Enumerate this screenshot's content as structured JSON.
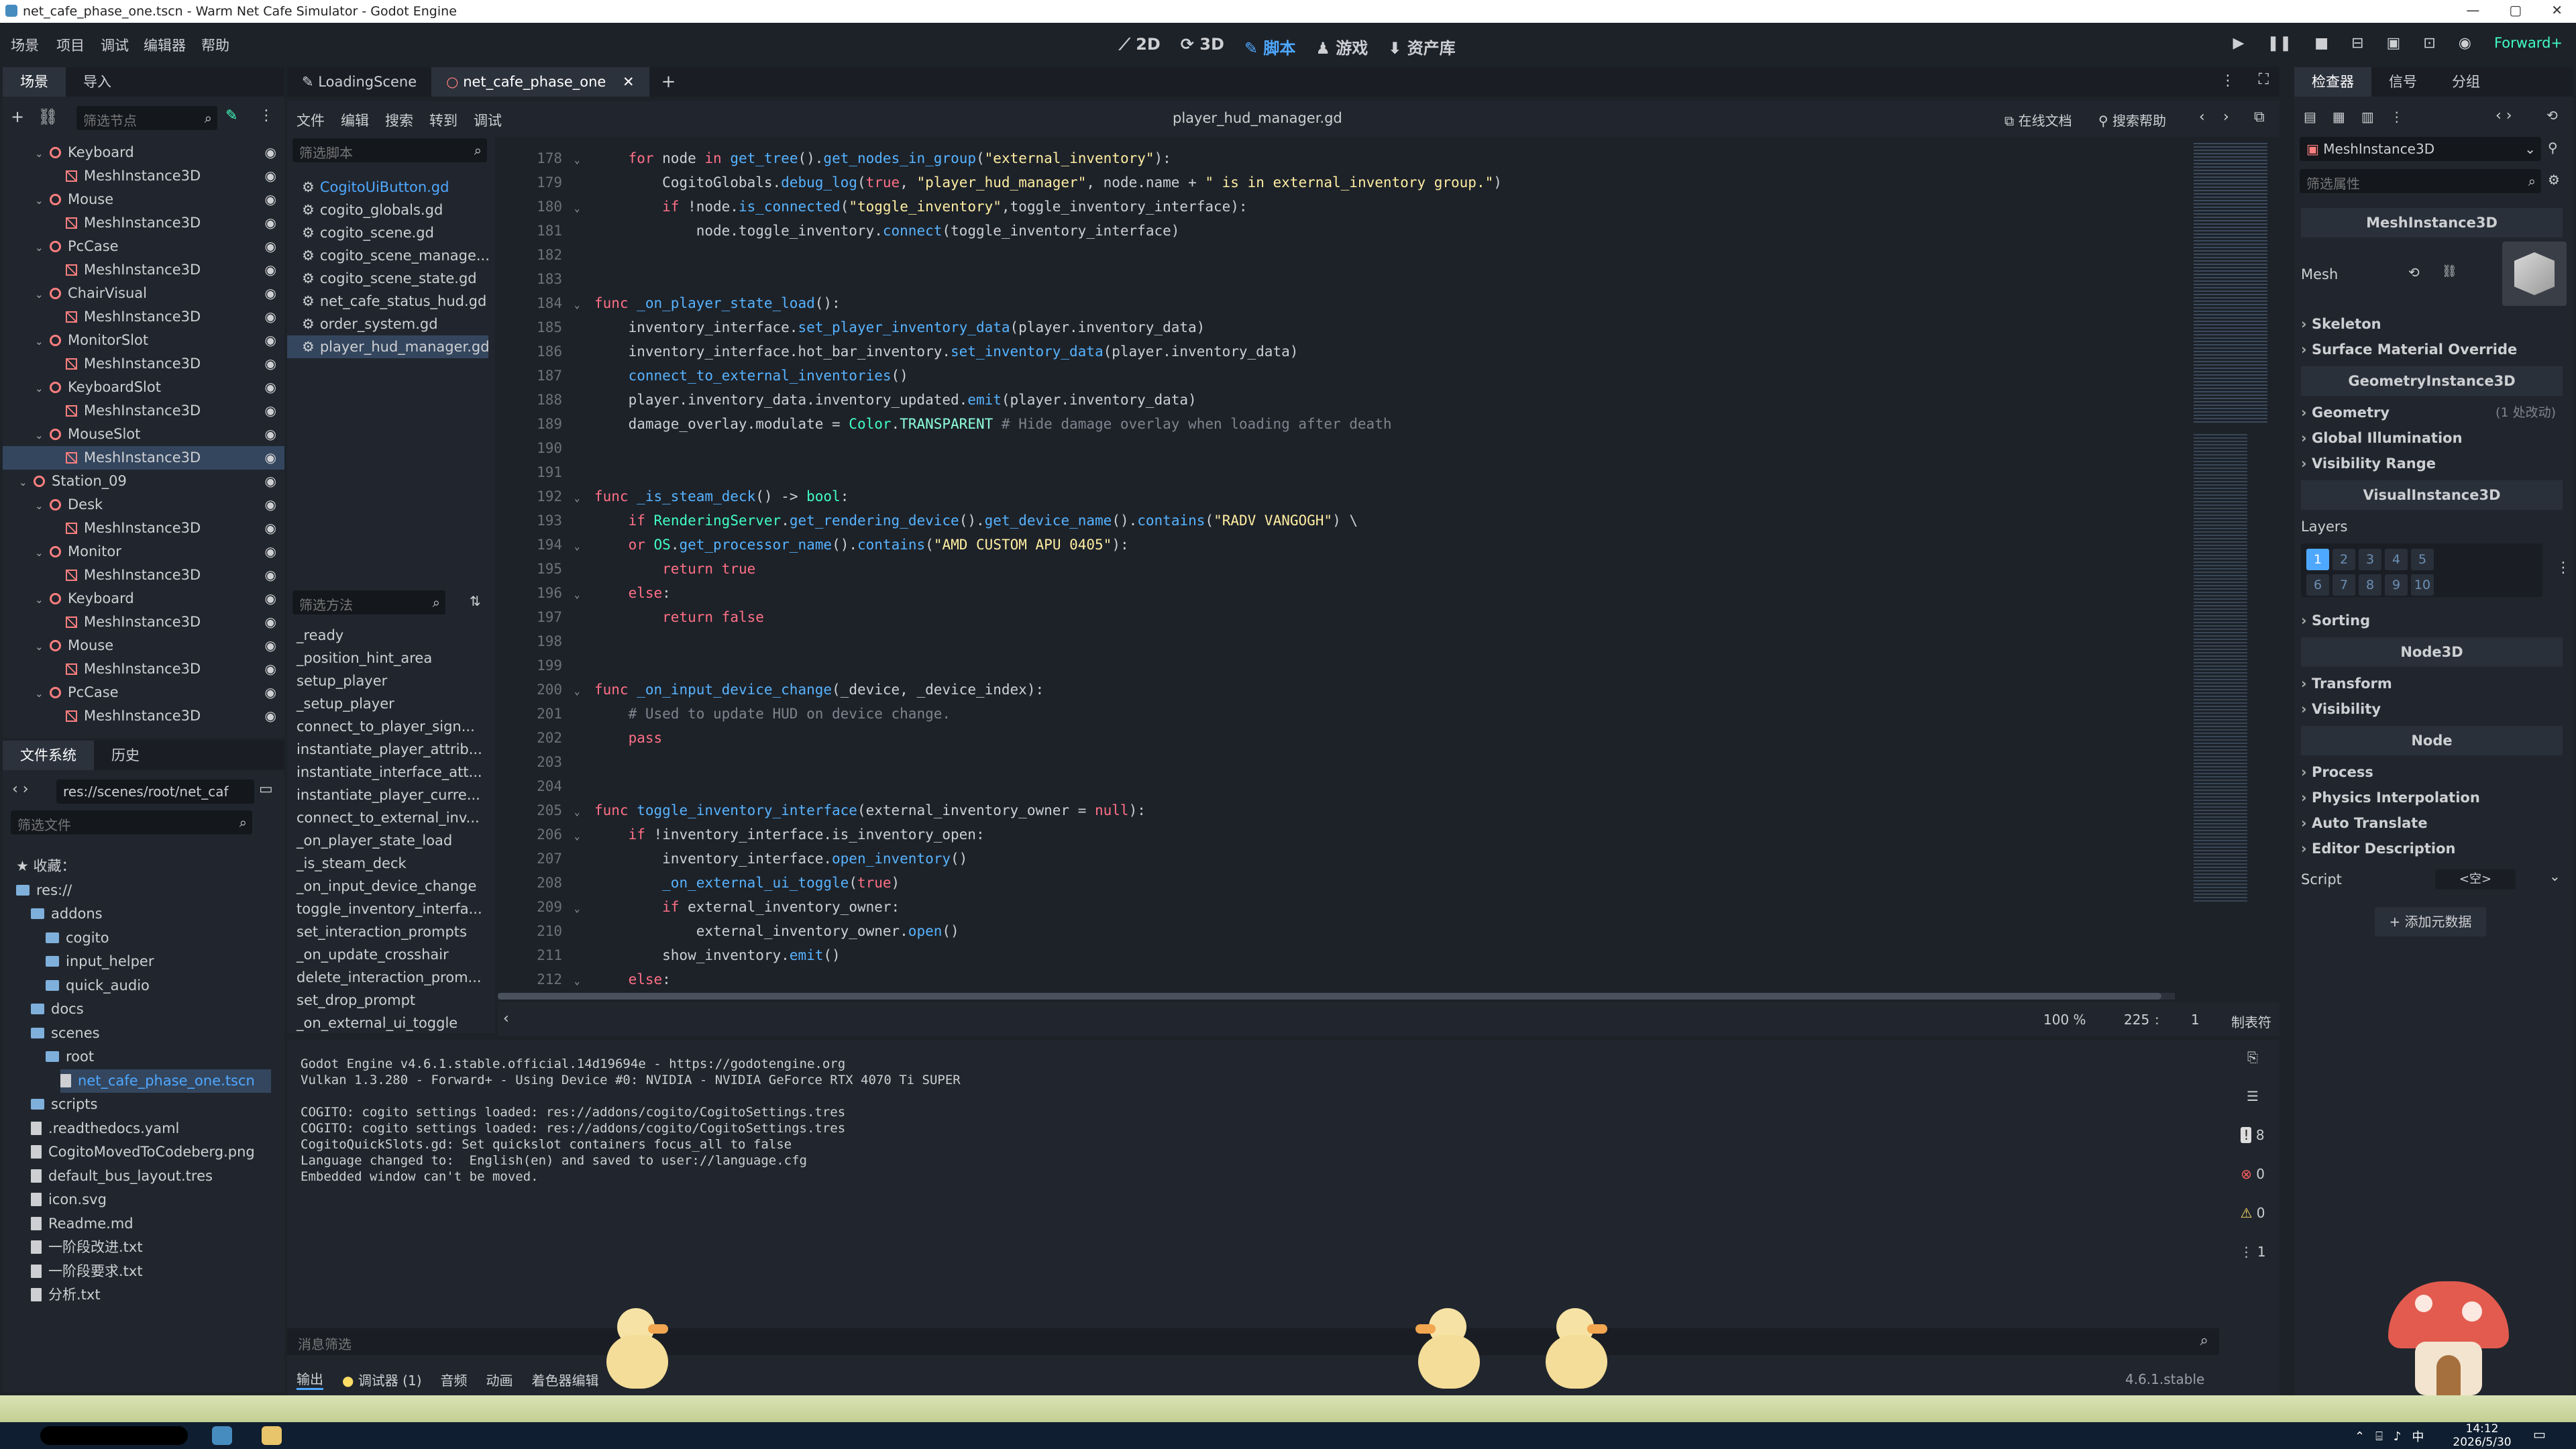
{
  "window": {
    "title": "net_cafe_phase_one.tscn - Warm Net Cafe Simulator - Godot Engine",
    "min": "—",
    "max": "▢",
    "close": "✕"
  },
  "menus": [
    "场景",
    "项目",
    "调试",
    "编辑器",
    "帮助"
  ],
  "workspaces": {
    "d2": "2D",
    "d3": "3D",
    "script": "脚本",
    "game": "游戏",
    "assetlib": "资产库"
  },
  "renderer": "Forward+",
  "scene_dock": {
    "tabs": [
      "场景",
      "导入"
    ],
    "filter_placeholder": "筛选节点",
    "tree": [
      {
        "label": "Keyboard",
        "type": "node",
        "indent": 2
      },
      {
        "label": "MeshInstance3D",
        "type": "mesh",
        "indent": 3
      },
      {
        "label": "Mouse",
        "type": "node",
        "indent": 2
      },
      {
        "label": "MeshInstance3D",
        "type": "mesh",
        "indent": 3
      },
      {
        "label": "PcCase",
        "type": "node",
        "indent": 2
      },
      {
        "label": "MeshInstance3D",
        "type": "mesh",
        "indent": 3
      },
      {
        "label": "ChairVisual",
        "type": "node",
        "indent": 2
      },
      {
        "label": "MeshInstance3D",
        "type": "mesh",
        "indent": 3
      },
      {
        "label": "MonitorSlot",
        "type": "node",
        "indent": 2
      },
      {
        "label": "MeshInstance3D",
        "type": "mesh",
        "indent": 3
      },
      {
        "label": "KeyboardSlot",
        "type": "node",
        "indent": 2
      },
      {
        "label": "MeshInstance3D",
        "type": "mesh",
        "indent": 3
      },
      {
        "label": "MouseSlot",
        "type": "node",
        "indent": 2
      },
      {
        "label": "MeshInstance3D",
        "type": "mesh",
        "indent": 3,
        "selected": true
      },
      {
        "label": "Station_09",
        "type": "node",
        "indent": 1
      },
      {
        "label": "Desk",
        "type": "node",
        "indent": 2
      },
      {
        "label": "MeshInstance3D",
        "type": "mesh",
        "indent": 3
      },
      {
        "label": "Monitor",
        "type": "node",
        "indent": 2
      },
      {
        "label": "MeshInstance3D",
        "type": "mesh",
        "indent": 3
      },
      {
        "label": "Keyboard",
        "type": "node",
        "indent": 2
      },
      {
        "label": "MeshInstance3D",
        "type": "mesh",
        "indent": 3
      },
      {
        "label": "Mouse",
        "type": "node",
        "indent": 2
      },
      {
        "label": "MeshInstance3D",
        "type": "mesh",
        "indent": 3
      },
      {
        "label": "PcCase",
        "type": "node",
        "indent": 2
      },
      {
        "label": "MeshInstance3D",
        "type": "mesh",
        "indent": 3
      }
    ]
  },
  "fs_dock": {
    "tabs": [
      "文件系统",
      "历史"
    ],
    "path": "res://scenes/root/net_caf",
    "filter_placeholder": "筛选文件",
    "items": [
      {
        "label": "收藏：",
        "kind": "star",
        "indent": 0
      },
      {
        "label": "res://",
        "kind": "folder",
        "indent": 0
      },
      {
        "label": "addons",
        "kind": "folder",
        "indent": 1
      },
      {
        "label": "cogito",
        "kind": "folder",
        "indent": 2
      },
      {
        "label": "input_helper",
        "kind": "folder",
        "indent": 2
      },
      {
        "label": "quick_audio",
        "kind": "folder",
        "indent": 2
      },
      {
        "label": "docs",
        "kind": "folder",
        "indent": 1
      },
      {
        "label": "scenes",
        "kind": "folder",
        "indent": 1
      },
      {
        "label": "root",
        "kind": "folder",
        "indent": 2
      },
      {
        "label": "net_cafe_phase_one.tscn",
        "kind": "scene",
        "indent": 3,
        "selected": true
      },
      {
        "label": "scripts",
        "kind": "folder",
        "indent": 1
      },
      {
        "label": ".readthedocs.yaml",
        "kind": "file",
        "indent": 1
      },
      {
        "label": "CogitoMovedToCodeberg.png",
        "kind": "file",
        "indent": 1
      },
      {
        "label": "default_bus_layout.tres",
        "kind": "file",
        "indent": 1
      },
      {
        "label": "icon.svg",
        "kind": "file",
        "indent": 1
      },
      {
        "label": "Readme.md",
        "kind": "file",
        "indent": 1
      },
      {
        "label": "一阶段改进.txt",
        "kind": "file",
        "indent": 1
      },
      {
        "label": "一阶段要求.txt",
        "kind": "file",
        "indent": 1
      },
      {
        "label": "分析.txt",
        "kind": "file",
        "indent": 1
      }
    ]
  },
  "scene_tabs": [
    "LoadingScene",
    "net_cafe_phase_one"
  ],
  "script_menu": [
    "文件",
    "编辑",
    "搜索",
    "转到",
    "调试"
  ],
  "script_title": "player_hud_manager.gd",
  "online_docs": "在线文档",
  "search_help": "搜索帮助",
  "script_filter_placeholder": "筛选脚本",
  "scripts": [
    "CogitoUiButton.gd",
    "cogito_globals.gd",
    "cogito_scene.gd",
    "cogito_scene_manage...",
    "cogito_scene_state.gd",
    "net_cafe_status_hud.gd",
    "order_system.gd",
    "player_hud_manager.gd"
  ],
  "method_filter_placeholder": "筛选方法",
  "methods": [
    "_ready",
    "_position_hint_area",
    "setup_player",
    "_setup_player",
    "connect_to_player_sign...",
    "instantiate_player_attrib...",
    "instantiate_interface_att...",
    "instantiate_player_curre...",
    "connect_to_external_inv...",
    "_on_player_state_load",
    "_is_steam_deck",
    "_on_input_device_change",
    "toggle_inventory_interfa...",
    "set_interaction_prompts",
    "_on_update_crosshair",
    "delete_interaction_prom...",
    "set_drop_prompt",
    "_on_external_ui_toggle"
  ],
  "code": [
    {
      "n": "178",
      "fold": "v",
      "t": [
        [
          "    ",
          ""
        ],
        [
          "for",
          "kw"
        ],
        [
          " node ",
          ""
        ],
        [
          "in",
          "kw"
        ],
        [
          " ",
          ""
        ],
        [
          "get_tree",
          "fn"
        ],
        [
          "().",
          ""
        ],
        [
          "get_nodes_in_group",
          "fn"
        ],
        [
          "(",
          ""
        ],
        [
          "\"external_inventory\"",
          "st"
        ],
        [
          "):",
          ""
        ]
      ]
    },
    {
      "n": "179",
      "fold": "",
      "t": [
        [
          "        CogitoGlobals.",
          ""
        ],
        [
          "debug_log",
          "fn"
        ],
        [
          "(",
          ""
        ],
        [
          "true",
          "kw"
        ],
        [
          ", ",
          ""
        ],
        [
          "\"player_hud_manager\"",
          "st"
        ],
        [
          ", node.name + ",
          ""
        ],
        [
          "\" is in external_inventory group.\"",
          "st"
        ],
        [
          ")",
          ""
        ]
      ]
    },
    {
      "n": "180",
      "fold": "v",
      "t": [
        [
          "        ",
          ""
        ],
        [
          "if",
          "kw"
        ],
        [
          " !node.",
          ""
        ],
        [
          "is_connected",
          "fn"
        ],
        [
          "(",
          ""
        ],
        [
          "\"toggle_inventory\"",
          "st"
        ],
        [
          ",toggle_inventory_interface):",
          ""
        ]
      ]
    },
    {
      "n": "181",
      "fold": "",
      "t": [
        [
          "            node.toggle_inventory.",
          ""
        ],
        [
          "connect",
          "fn"
        ],
        [
          "(toggle_inventory_interface)",
          ""
        ]
      ]
    },
    {
      "n": "182",
      "fold": "",
      "t": []
    },
    {
      "n": "183",
      "fold": "",
      "t": []
    },
    {
      "n": "184",
      "fold": "v",
      "t": [
        [
          "func",
          "kw"
        ],
        [
          " ",
          ""
        ],
        [
          "_on_player_state_load",
          "fn"
        ],
        [
          "():",
          ""
        ]
      ]
    },
    {
      "n": "185",
      "fold": "",
      "t": [
        [
          "    inventory_interface.",
          ""
        ],
        [
          "set_player_inventory_data",
          "fn"
        ],
        [
          "(player.inventory_data)",
          ""
        ]
      ]
    },
    {
      "n": "186",
      "fold": "",
      "t": [
        [
          "    inventory_interface.hot_bar_inventory.",
          ""
        ],
        [
          "set_inventory_data",
          "fn"
        ],
        [
          "(player.inventory_data)",
          ""
        ]
      ]
    },
    {
      "n": "187",
      "fold": "",
      "t": [
        [
          "    ",
          ""
        ],
        [
          "connect_to_external_inventories",
          "fn"
        ],
        [
          "()",
          ""
        ]
      ]
    },
    {
      "n": "188",
      "fold": "",
      "t": [
        [
          "    player.inventory_data.inventory_updated.",
          ""
        ],
        [
          "emit",
          "fn"
        ],
        [
          "(player.inventory_data)",
          ""
        ]
      ]
    },
    {
      "n": "189",
      "fold": "",
      "t": [
        [
          "    damage_overlay.modulate = ",
          ""
        ],
        [
          "Color",
          "ty"
        ],
        [
          ".",
          ""
        ],
        [
          "TRANSPARENT",
          "cl"
        ],
        [
          " ",
          ""
        ],
        [
          "# Hide damage overlay when loading after death",
          "cm"
        ]
      ]
    },
    {
      "n": "190",
      "fold": "",
      "t": []
    },
    {
      "n": "191",
      "fold": "",
      "t": []
    },
    {
      "n": "192",
      "fold": "v",
      "t": [
        [
          "func",
          "kw"
        ],
        [
          " ",
          ""
        ],
        [
          "_is_steam_deck",
          "fn"
        ],
        [
          "() -> ",
          ""
        ],
        [
          "bool",
          "ty"
        ],
        [
          ":",
          ""
        ]
      ]
    },
    {
      "n": "193",
      "fold": "",
      "t": [
        [
          "    ",
          ""
        ],
        [
          "if",
          "kw"
        ],
        [
          " ",
          ""
        ],
        [
          "RenderingServer",
          "ty"
        ],
        [
          ".",
          ""
        ],
        [
          "get_rendering_device",
          "fn"
        ],
        [
          "().",
          ""
        ],
        [
          "get_device_name",
          "fn"
        ],
        [
          "().",
          ""
        ],
        [
          "contains",
          "fn"
        ],
        [
          "(",
          ""
        ],
        [
          "\"RADV VANGOGH\"",
          "st"
        ],
        [
          ") \\",
          ""
        ]
      ]
    },
    {
      "n": "194",
      "fold": "v",
      "t": [
        [
          "    ",
          ""
        ],
        [
          "or",
          "kw"
        ],
        [
          " ",
          ""
        ],
        [
          "OS",
          "ty"
        ],
        [
          ".",
          ""
        ],
        [
          "get_processor_name",
          "fn"
        ],
        [
          "().",
          ""
        ],
        [
          "contains",
          "fn"
        ],
        [
          "(",
          ""
        ],
        [
          "\"AMD CUSTOM APU 0405\"",
          "st"
        ],
        [
          "):",
          ""
        ]
      ]
    },
    {
      "n": "195",
      "fold": "",
      "t": [
        [
          "        ",
          ""
        ],
        [
          "return",
          "kw"
        ],
        [
          " ",
          ""
        ],
        [
          "true",
          "kw"
        ]
      ]
    },
    {
      "n": "196",
      "fold": "v",
      "t": [
        [
          "    ",
          ""
        ],
        [
          "else",
          "kw"
        ],
        [
          ":",
          ""
        ]
      ]
    },
    {
      "n": "197",
      "fold": "",
      "t": [
        [
          "        ",
          ""
        ],
        [
          "return",
          "kw"
        ],
        [
          " ",
          ""
        ],
        [
          "false",
          "kw"
        ]
      ]
    },
    {
      "n": "198",
      "fold": "",
      "t": []
    },
    {
      "n": "199",
      "fold": "",
      "t": []
    },
    {
      "n": "200",
      "fold": "v",
      "t": [
        [
          "func",
          "kw"
        ],
        [
          " ",
          ""
        ],
        [
          "_on_input_device_change",
          "fn"
        ],
        [
          "(_device, _device_index):",
          ""
        ]
      ]
    },
    {
      "n": "201",
      "fold": "",
      "t": [
        [
          "    ",
          ""
        ],
        [
          "# Used to update HUD on device change.",
          "cm"
        ]
      ]
    },
    {
      "n": "202",
      "fold": "",
      "t": [
        [
          "    ",
          ""
        ],
        [
          "pass",
          "kw"
        ]
      ]
    },
    {
      "n": "203",
      "fold": "",
      "t": []
    },
    {
      "n": "204",
      "fold": "",
      "t": []
    },
    {
      "n": "205",
      "fold": "v",
      "t": [
        [
          "func",
          "kw"
        ],
        [
          " ",
          ""
        ],
        [
          "toggle_inventory_interface",
          "fn"
        ],
        [
          "(external_inventory_owner = ",
          ""
        ],
        [
          "null",
          "kw"
        ],
        [
          "):",
          ""
        ]
      ]
    },
    {
      "n": "206",
      "fold": "v",
      "t": [
        [
          "    ",
          ""
        ],
        [
          "if",
          "kw"
        ],
        [
          " !inventory_interface.is_inventory_open:",
          ""
        ]
      ]
    },
    {
      "n": "207",
      "fold": "",
      "t": [
        [
          "        inventory_interface.",
          ""
        ],
        [
          "open_inventory",
          "fn"
        ],
        [
          "()",
          ""
        ]
      ]
    },
    {
      "n": "208",
      "fold": "",
      "t": [
        [
          "        ",
          ""
        ],
        [
          "_on_external_ui_toggle",
          "fn"
        ],
        [
          "(",
          ""
        ],
        [
          "true",
          "kw"
        ],
        [
          ")",
          ""
        ]
      ]
    },
    {
      "n": "209",
      "fold": "v",
      "t": [
        [
          "        ",
          ""
        ],
        [
          "if",
          "kw"
        ],
        [
          " external_inventory_owner:",
          ""
        ]
      ]
    },
    {
      "n": "210",
      "fold": "",
      "t": [
        [
          "            external_inventory_owner.",
          ""
        ],
        [
          "open",
          "fn"
        ],
        [
          "()",
          ""
        ]
      ]
    },
    {
      "n": "211",
      "fold": "",
      "t": [
        [
          "        show_inventory.",
          ""
        ],
        [
          "emit",
          "fn"
        ],
        [
          "()",
          ""
        ]
      ]
    },
    {
      "n": "212",
      "fold": "v",
      "t": [
        [
          "    ",
          ""
        ],
        [
          "else",
          "kw"
        ],
        [
          ":",
          ""
        ]
      ]
    }
  ],
  "status": {
    "zoom": "100 %",
    "line": "225",
    "col": "1",
    "indent": "制表符"
  },
  "output": {
    "lines": [
      "Godot Engine v4.6.1.stable.official.14d19694e - https://godotengine.org",
      "Vulkan 1.3.280 - Forward+ - Using Device #0: NVIDIA - NVIDIA GeForce RTX 4070 Ti SUPER",
      "",
      "COGITO: cogito settings loaded: res://addons/cogito/CogitoSettings.tres",
      "COGITO: cogito settings loaded: res://addons/cogito/CogitoSettings.tres",
      "CogitoQuickSlots.gd: Set quickslot containers focus_all to false",
      "Language changed to:  English(en) and saved to user://language.cfg",
      "Embedded window can't be moved."
    ],
    "filter_placeholder": "消息筛选",
    "counts": {
      "messages": "8",
      "errors": "0",
      "warnings": "0",
      "other": "1"
    }
  },
  "bottom_tabs": [
    "输出",
    "调试器 (1)",
    "音频",
    "动画",
    "着色器编辑"
  ],
  "version": "4.6.1.stable",
  "inspector": {
    "tabs": [
      "检查器",
      "信号",
      "分组"
    ],
    "node_type": "MeshInstance3D",
    "filter_placeholder": "筛选属性",
    "sections": [
      {
        "kind": "head",
        "label": "MeshInstance3D"
      },
      {
        "kind": "mesh",
        "label": "Mesh"
      },
      {
        "kind": "sec",
        "label": "Skeleton"
      },
      {
        "kind": "sec",
        "label": "Surface Material Override"
      },
      {
        "kind": "head",
        "label": "GeometryInstance3D"
      },
      {
        "kind": "sec",
        "label": "Geometry",
        "note": "(1 处改动)"
      },
      {
        "kind": "sec",
        "label": "Global Illumination"
      },
      {
        "kind": "sec",
        "label": "Visibility Range"
      },
      {
        "kind": "head",
        "label": "VisualInstance3D"
      },
      {
        "kind": "layers",
        "label": "Layers"
      },
      {
        "kind": "sec",
        "label": "Sorting"
      },
      {
        "kind": "head",
        "label": "Node3D"
      },
      {
        "kind": "sec",
        "label": "Transform"
      },
      {
        "kind": "sec",
        "label": "Visibility"
      },
      {
        "kind": "head",
        "label": "Node"
      },
      {
        "kind": "sec",
        "label": "Process"
      },
      {
        "kind": "sec",
        "label": "Physics Interpolation"
      },
      {
        "kind": "sec",
        "label": "Auto Translate"
      },
      {
        "kind": "sec",
        "label": "Editor Description"
      }
    ],
    "layers": [
      "1",
      "2",
      "3",
      "4",
      "5",
      "6",
      "7",
      "8",
      "9",
      "10"
    ],
    "script_label": "Script",
    "script_value": "<空>",
    "add_meta": "添加元数据"
  },
  "taskbar": {
    "time": "14:12",
    "date": "2026/5/30",
    "ime": "中"
  },
  "colors": {
    "accent": "#4fa8ff",
    "selection": "#34465e",
    "keyword": "#ff7085",
    "function": "#57b3ff",
    "string": "#ffeda1",
    "comment": "#7e848e",
    "type": "#42ffc2"
  }
}
